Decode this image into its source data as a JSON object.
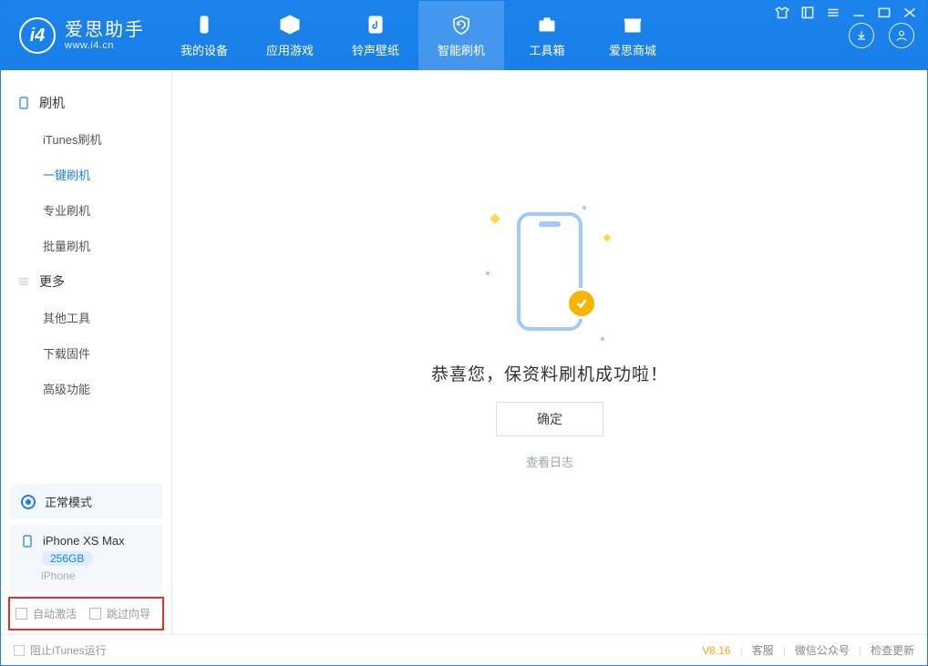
{
  "brand": {
    "cn": "爱思助手",
    "en": "www.i4.cn"
  },
  "nav": [
    {
      "label": "我的设备",
      "icon": "device"
    },
    {
      "label": "应用游戏",
      "icon": "cube"
    },
    {
      "label": "铃声壁纸",
      "icon": "music"
    },
    {
      "label": "智能刷机",
      "icon": "refresh",
      "active": true
    },
    {
      "label": "工具箱",
      "icon": "briefcase"
    },
    {
      "label": "爱思商城",
      "icon": "store"
    }
  ],
  "sidebar": {
    "group1_title": "刷机",
    "group1_items": [
      "iTunes刷机",
      "一键刷机",
      "专业刷机",
      "批量刷机"
    ],
    "group1_active_index": 1,
    "group2_title": "更多",
    "group2_items": [
      "其他工具",
      "下载固件",
      "高级功能"
    ],
    "mode_label": "正常模式",
    "device_name": "iPhone XS Max",
    "device_capacity": "256GB",
    "device_type": "iPhone",
    "cb_auto_activate": "自动激活",
    "cb_skip_guide": "跳过向导"
  },
  "main": {
    "success_text": "恭喜您，保资料刷机成功啦！",
    "ok_button": "确定",
    "view_log": "查看日志"
  },
  "footer": {
    "block_itunes": "阻止iTunes运行",
    "version": "V8.16",
    "links": [
      "客服",
      "微信公众号",
      "检查更新"
    ]
  }
}
